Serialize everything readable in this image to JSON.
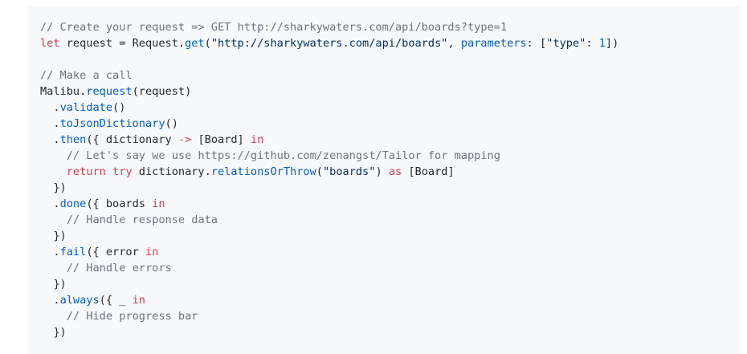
{
  "colors": {
    "background": "#f6f8fa",
    "text": "#24292e",
    "comment": "#6a737d",
    "keyword": "#d73a49",
    "function": "#005cc5",
    "string": "#032f62"
  },
  "code": {
    "lines": [
      [
        {
          "t": "c",
          "v": "// Create your request => GET http://sharkywaters.com/api/boards?type=1"
        }
      ],
      [
        {
          "t": "k",
          "v": "let"
        },
        {
          "t": "n",
          "v": " request = Request."
        },
        {
          "t": "f",
          "v": "get"
        },
        {
          "t": "n",
          "v": "("
        },
        {
          "t": "s",
          "v": "\"http://sharkywaters.com/api/boards\""
        },
        {
          "t": "n",
          "v": ", "
        },
        {
          "t": "f",
          "v": "parameters"
        },
        {
          "t": "n",
          "v": ": ["
        },
        {
          "t": "s",
          "v": "\"type\""
        },
        {
          "t": "n",
          "v": ": "
        },
        {
          "t": "f",
          "v": "1"
        },
        {
          "t": "n",
          "v": "])"
        }
      ],
      [],
      [
        {
          "t": "c",
          "v": "// Make a call"
        }
      ],
      [
        {
          "t": "n",
          "v": "Malibu."
        },
        {
          "t": "f",
          "v": "request"
        },
        {
          "t": "n",
          "v": "(request)"
        }
      ],
      [
        {
          "t": "n",
          "v": "  ."
        },
        {
          "t": "f",
          "v": "validate"
        },
        {
          "t": "n",
          "v": "()"
        }
      ],
      [
        {
          "t": "n",
          "v": "  ."
        },
        {
          "t": "f",
          "v": "toJsonDictionary"
        },
        {
          "t": "n",
          "v": "()"
        }
      ],
      [
        {
          "t": "n",
          "v": "  ."
        },
        {
          "t": "f",
          "v": "then"
        },
        {
          "t": "n",
          "v": "({ dictionary "
        },
        {
          "t": "k",
          "v": "->"
        },
        {
          "t": "n",
          "v": " [Board] "
        },
        {
          "t": "k",
          "v": "in"
        }
      ],
      [
        {
          "t": "n",
          "v": "    "
        },
        {
          "t": "c",
          "v": "// Let's say we use https://github.com/zenangst/Tailor for mapping"
        }
      ],
      [
        {
          "t": "n",
          "v": "    "
        },
        {
          "t": "k",
          "v": "return try"
        },
        {
          "t": "n",
          "v": " dictionary."
        },
        {
          "t": "f",
          "v": "relationsOrThrow"
        },
        {
          "t": "n",
          "v": "("
        },
        {
          "t": "s",
          "v": "\"boards\""
        },
        {
          "t": "n",
          "v": ") "
        },
        {
          "t": "k",
          "v": "as"
        },
        {
          "t": "n",
          "v": " [Board]"
        }
      ],
      [
        {
          "t": "n",
          "v": "  })"
        }
      ],
      [
        {
          "t": "n",
          "v": "  ."
        },
        {
          "t": "f",
          "v": "done"
        },
        {
          "t": "n",
          "v": "({ boards "
        },
        {
          "t": "k",
          "v": "in"
        }
      ],
      [
        {
          "t": "n",
          "v": "    "
        },
        {
          "t": "c",
          "v": "// Handle response data"
        }
      ],
      [
        {
          "t": "n",
          "v": "  })"
        }
      ],
      [
        {
          "t": "n",
          "v": "  ."
        },
        {
          "t": "f",
          "v": "fail"
        },
        {
          "t": "n",
          "v": "({ error "
        },
        {
          "t": "k",
          "v": "in"
        }
      ],
      [
        {
          "t": "n",
          "v": "    "
        },
        {
          "t": "c",
          "v": "// Handle errors"
        }
      ],
      [
        {
          "t": "n",
          "v": "  })"
        }
      ],
      [
        {
          "t": "n",
          "v": "  ."
        },
        {
          "t": "f",
          "v": "always"
        },
        {
          "t": "n",
          "v": "({ _ "
        },
        {
          "t": "k",
          "v": "in"
        }
      ],
      [
        {
          "t": "n",
          "v": "    "
        },
        {
          "t": "c",
          "v": "// Hide progress bar"
        }
      ],
      [
        {
          "t": "n",
          "v": "  })"
        }
      ]
    ]
  }
}
